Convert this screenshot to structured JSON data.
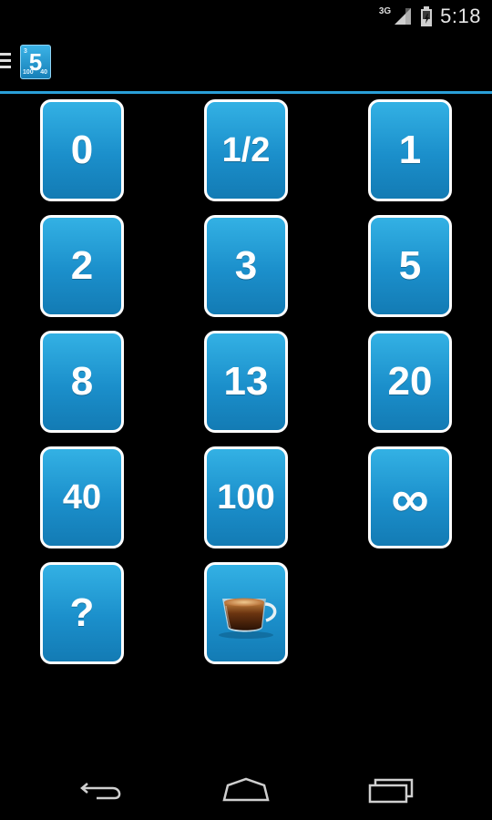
{
  "status_bar": {
    "network": "3G",
    "time": "5:18",
    "icons": [
      "signal-icon",
      "battery-icon"
    ]
  },
  "action_bar": {
    "menu_icon": "drawer-icon",
    "app_icon_value": "5",
    "app_icon_mini": [
      "3",
      "100",
      "40"
    ]
  },
  "cards": [
    {
      "label": "0"
    },
    {
      "label": "1/2"
    },
    {
      "label": "1"
    },
    {
      "label": "2"
    },
    {
      "label": "3"
    },
    {
      "label": "5"
    },
    {
      "label": "8"
    },
    {
      "label": "13"
    },
    {
      "label": "20"
    },
    {
      "label": "40"
    },
    {
      "label": "100"
    },
    {
      "label": "∞"
    },
    {
      "label": "?"
    },
    {
      "label": "",
      "icon": "coffee-cup-icon"
    }
  ],
  "nav_bar": {
    "buttons": [
      "back-icon",
      "home-icon",
      "recent-apps-icon"
    ]
  },
  "colors": {
    "accent": "#2a9fd8",
    "card_top": "#33b1e4",
    "card_bottom": "#137bb4",
    "card_border": "#ffffff",
    "background": "#000000"
  }
}
